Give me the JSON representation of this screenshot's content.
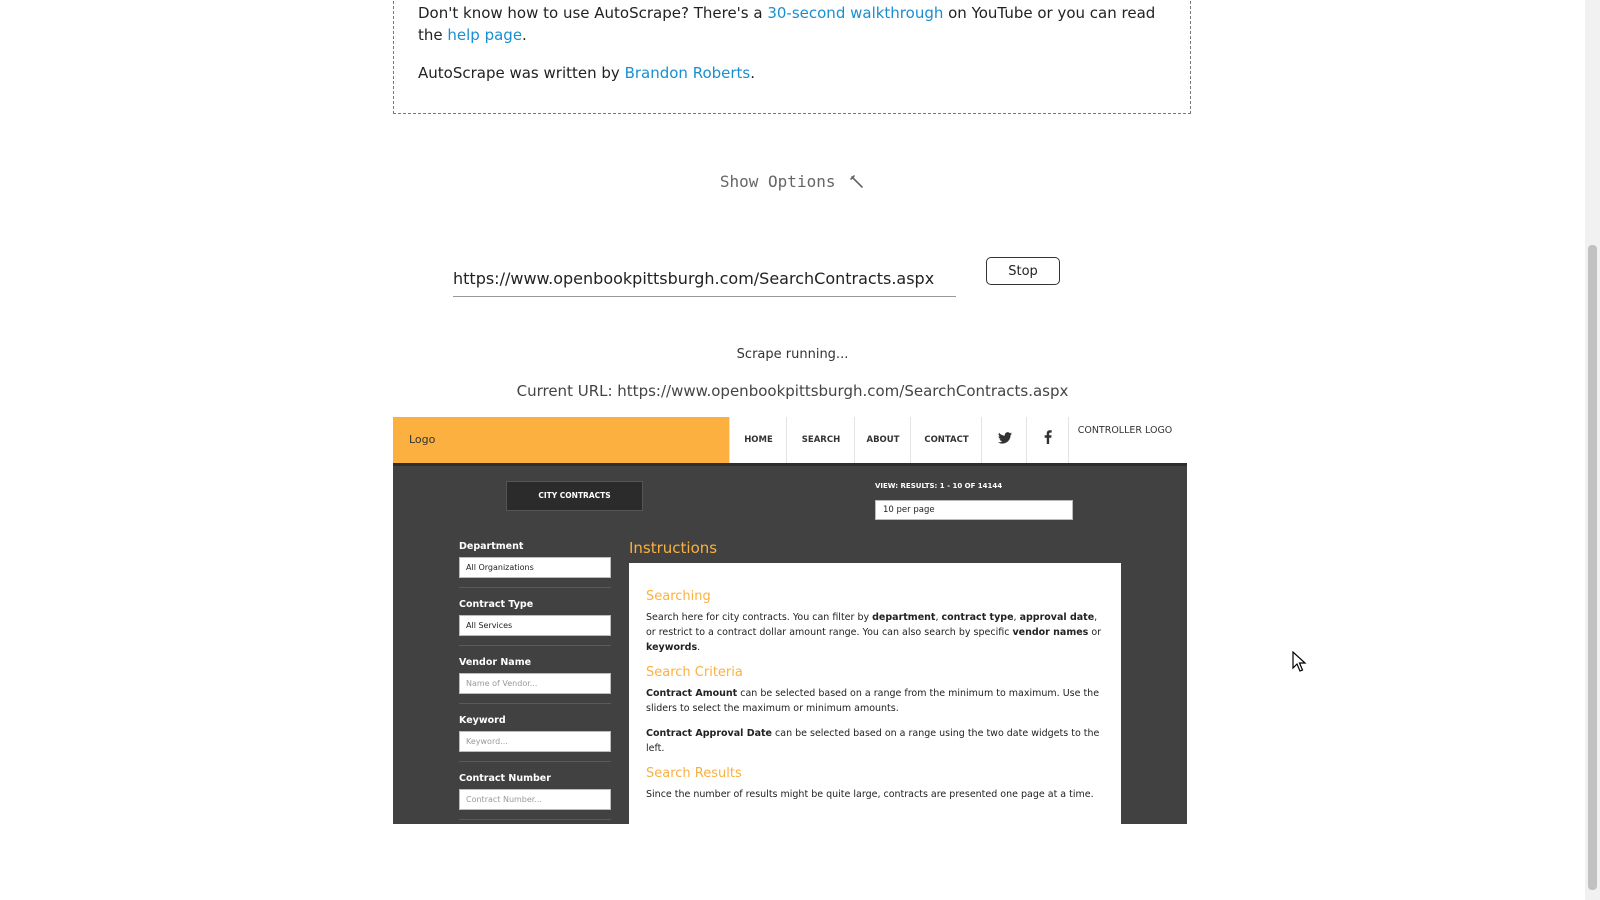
{
  "info": {
    "p1_before": "Don't know how to use AutoScrape? There's a ",
    "walkthrough_link": "30-second walkthrough",
    "p1_middle": " on YouTube or you can read the ",
    "help_link": "help page",
    "p1_end": ".",
    "p2_before": "AutoScrape was written by ",
    "author_link": "Brandon Roberts",
    "p2_end": "."
  },
  "options": {
    "label": "Show Options",
    "icon": "wrench-icon"
  },
  "scrape": {
    "url_value": "https://www.openbookpittsburgh.com/SearchContracts.aspx",
    "stop_label": "Stop",
    "status": "Scrape running...",
    "current_url": "Current URL: https://www.openbookpittsburgh.com/SearchContracts.aspx"
  },
  "preview": {
    "logo": "Logo",
    "nav": [
      "HOME",
      "SEARCH",
      "ABOUT",
      "CONTACT"
    ],
    "controller_logo": "CONTROLLER LOGO",
    "tab": "CITY CONTRACTS",
    "view_results": "VIEW: RESULTS: 1 - 10 OF 14144",
    "per_page": "10 per page",
    "filters": {
      "department_label": "Department",
      "department_value": "All Organizations",
      "contract_type_label": "Contract Type",
      "contract_type_value": "All Services",
      "vendor_label": "Vendor Name",
      "vendor_placeholder": "Name of Vendor...",
      "keyword_label": "Keyword",
      "keyword_placeholder": "Keyword...",
      "contract_number_label": "Contract Number",
      "contract_number_placeholder": "Contract Number..."
    },
    "instructions": {
      "title": "Instructions",
      "searching_heading": "Searching",
      "searching_t1": "Search here for city contracts. You can filter by ",
      "searching_b1": "department",
      "searching_t2": ", ",
      "searching_b2": "contract type",
      "searching_t3": ", ",
      "searching_b3": "approval date",
      "searching_t4": ", or restrict to a contract dollar amount range. You can also search by specific ",
      "searching_b4": "vendor names",
      "searching_t5": " or ",
      "searching_b5": "keywords",
      "searching_t6": ".",
      "criteria_heading": "Search Criteria",
      "criteria_b1": "Contract Amount",
      "criteria_t1": " can be selected based on a range from the minimum to maximum. Use the sliders to select the maximum or minimum amounts.",
      "criteria_b2": "Contract Approval Date",
      "criteria_t2": " can be selected based on a range using the two date widgets to the left.",
      "results_heading": "Search Results",
      "results_text": "Since the number of results might be quite large, contracts are presented one page at a time."
    }
  }
}
